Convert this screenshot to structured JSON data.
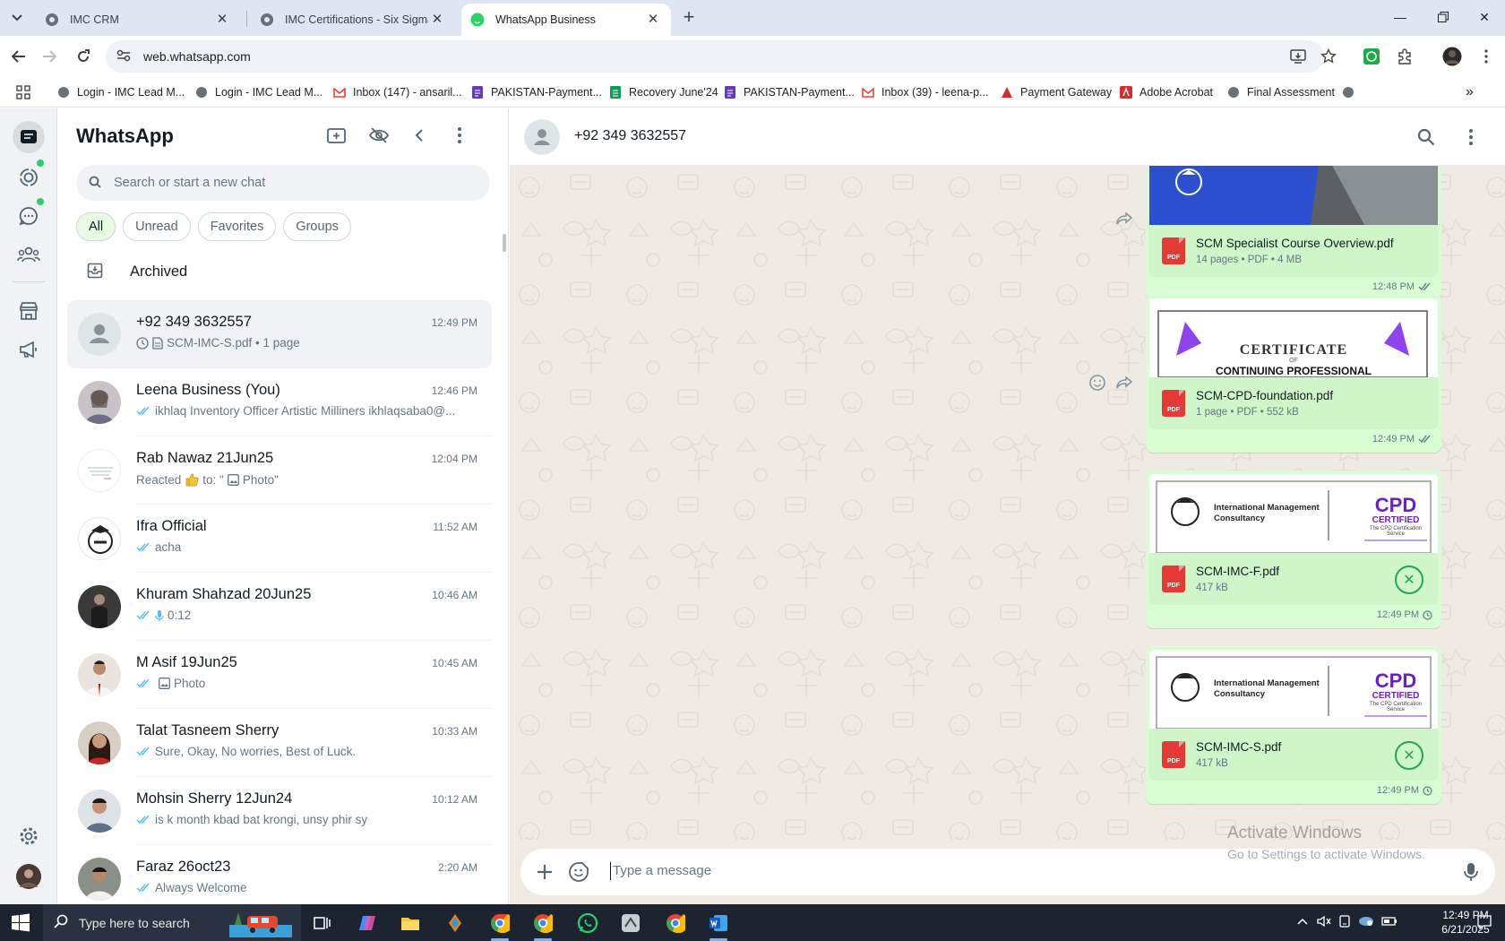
{
  "browser": {
    "tabs": [
      {
        "title": "IMC CRM"
      },
      {
        "title": "IMC Certifications - Six Sigma G"
      },
      {
        "title": "WhatsApp Business"
      }
    ],
    "url": "web.whatsapp.com",
    "bookmarks": [
      {
        "label": "Login - IMC Lead M..."
      },
      {
        "label": "Login - IMC Lead M..."
      },
      {
        "label": "Inbox (147) - ansaril..."
      },
      {
        "label": "PAKISTAN-Payment..."
      },
      {
        "label": "Recovery June'24"
      },
      {
        "label": "PAKISTAN-Payment..."
      },
      {
        "label": "Inbox (39) - leena-p..."
      },
      {
        "label": "Payment Gateway"
      },
      {
        "label": "Adobe Acrobat"
      },
      {
        "label": "Final Assessment"
      }
    ]
  },
  "sidebar": {
    "title": "WhatsApp",
    "search_placeholder": "Search or start a new chat",
    "filters": [
      "All",
      "Unread",
      "Favorites",
      "Groups"
    ],
    "archived_label": "Archived",
    "chats": [
      {
        "name": "+92 349 3632557",
        "time": "12:49 PM",
        "preview": "SCM-IMC-S.pdf • 1 page"
      },
      {
        "name": "Leena Business (You)",
        "time": "12:46 PM",
        "preview": "ikhlaq Inventory Officer Artistic Milliners ikhlaqsaba0@..."
      },
      {
        "name": "Rab Nawaz 21Jun25",
        "time": "12:04 PM",
        "preview_pre": "Reacted",
        "preview_post": "to: \"",
        "preview_photo": "Photo\""
      },
      {
        "name": "Ifra Official",
        "time": "11:52 AM",
        "preview": "acha"
      },
      {
        "name": "Khuram Shahzad 20Jun25",
        "time": "10:46 AM",
        "preview": "0:12"
      },
      {
        "name": "M Asif 19Jun25",
        "time": "10:45 AM",
        "preview": "Photo"
      },
      {
        "name": "Talat Tasneem Sherry",
        "time": "10:33 AM",
        "preview": "Sure, Okay, No worries, Best of Luck."
      },
      {
        "name": "Mohsin Sherry 12Jun24",
        "time": "10:12 AM",
        "preview": "is k month kbad bat krongi, unsy phir sy"
      },
      {
        "name": "Faraz 26oct23",
        "time": "2:20 AM",
        "preview": "Always Welcome"
      }
    ]
  },
  "conversation": {
    "contact": "+92 349 3632557",
    "messages": [
      {
        "file": "SCM Specialist Course Overview.pdf",
        "meta": "14 pages • PDF • 4 MB",
        "time": "12:48 PM"
      },
      {
        "file": "SCM-CPD-foundation.pdf",
        "meta": "1 page • PDF • 552 kB",
        "time": "12:49 PM",
        "thumb_title": "CERTIFICATE",
        "thumb_of": "OF",
        "thumb_sub": "CONTINUING PROFESSIONAL"
      },
      {
        "file": "SCM-IMC-F.pdf",
        "meta": "417 kB",
        "time": "12:49 PM",
        "thumb_org": "International Management Consultancy",
        "thumb_badge": "CPD",
        "thumb_badge2": "CERTIFIED",
        "thumb_badge3": "The CPD Certification Service"
      },
      {
        "file": "SCM-IMC-S.pdf",
        "meta": "417 kB",
        "time": "12:49 PM",
        "thumb_org": "International Management Consultancy",
        "thumb_badge": "CPD",
        "thumb_badge2": "CERTIFIED",
        "thumb_badge3": "The CPD Certification Service"
      }
    ],
    "compose_placeholder": "Type a message"
  },
  "watermark": {
    "line1": "Activate Windows",
    "line2": "Go to Settings to activate Windows."
  },
  "taskbar": {
    "search_placeholder": "Type here to search",
    "time": "12:49 PM",
    "date": "6/21/2025"
  },
  "colors": {
    "accent": "#25d366",
    "bubble": "#d9fdd3",
    "chat_bg": "#efeae2",
    "taskbar": "#1d2431"
  }
}
